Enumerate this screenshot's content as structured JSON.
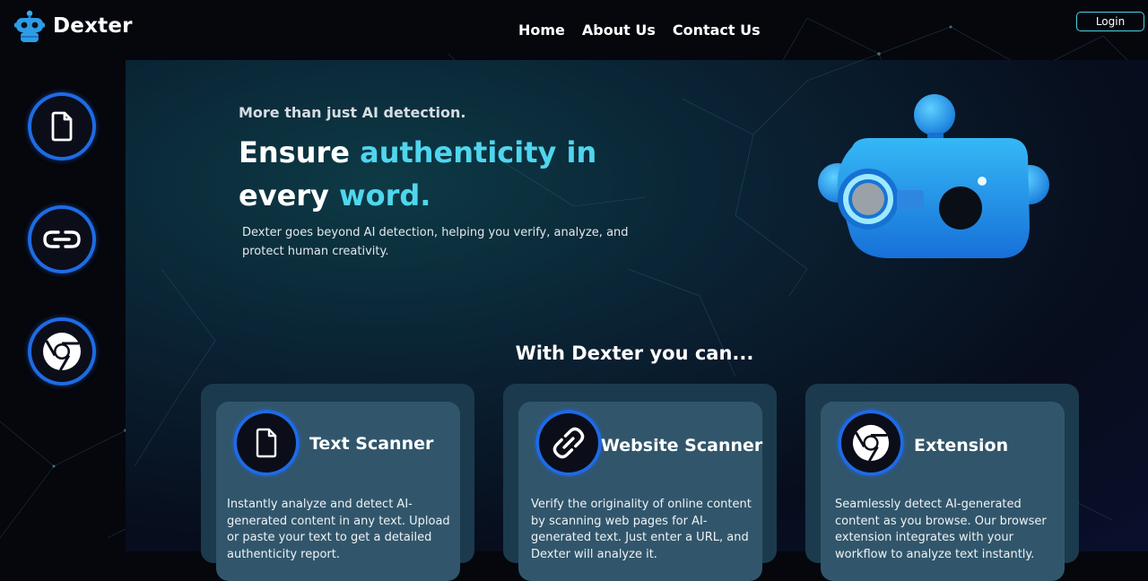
{
  "header": {
    "logo_icon": "robot-icon",
    "brand": "Dexter",
    "nav": [
      {
        "label": "Home"
      },
      {
        "label": "About Us"
      },
      {
        "label": "Contact Us"
      }
    ],
    "login_label": "Login"
  },
  "sidebar": {
    "items": [
      {
        "icon": "document-icon"
      },
      {
        "icon": "link-icon"
      },
      {
        "icon": "chrome-icon"
      }
    ]
  },
  "hero": {
    "eyebrow": "More than just AI detection.",
    "title_part1": "Ensure ",
    "title_accent1": "authenticity in",
    "title_part2": "every ",
    "title_accent2": "word.",
    "description": "Dexter goes beyond AI detection, helping you verify, analyze, and protect human creativity."
  },
  "features": {
    "heading": "With Dexter you can...",
    "cards": [
      {
        "icon": "document-icon",
        "title": "Text Scanner",
        "text": "Instantly analyze and detect AI-generated content in any text. Upload or paste your text to get a detailed authenticity report."
      },
      {
        "icon": "link-icon",
        "title": "Website  Scanner",
        "text": "Verify the originality of online content by scanning web pages for AI-generated text. Just enter a URL, and Dexter will analyze it."
      },
      {
        "icon": "chrome-icon",
        "title": "Extension",
        "text": "Seamlessly detect AI-generated content as you browse. Our browser extension integrates with your workflow to analyze text instantly."
      }
    ]
  },
  "colors": {
    "accent": "#4fd6ee",
    "icon_ring": "#1e6be6",
    "card_outer": "#1c3a4d",
    "card_inner": "#31566b",
    "robot": "#1e9fe8"
  }
}
